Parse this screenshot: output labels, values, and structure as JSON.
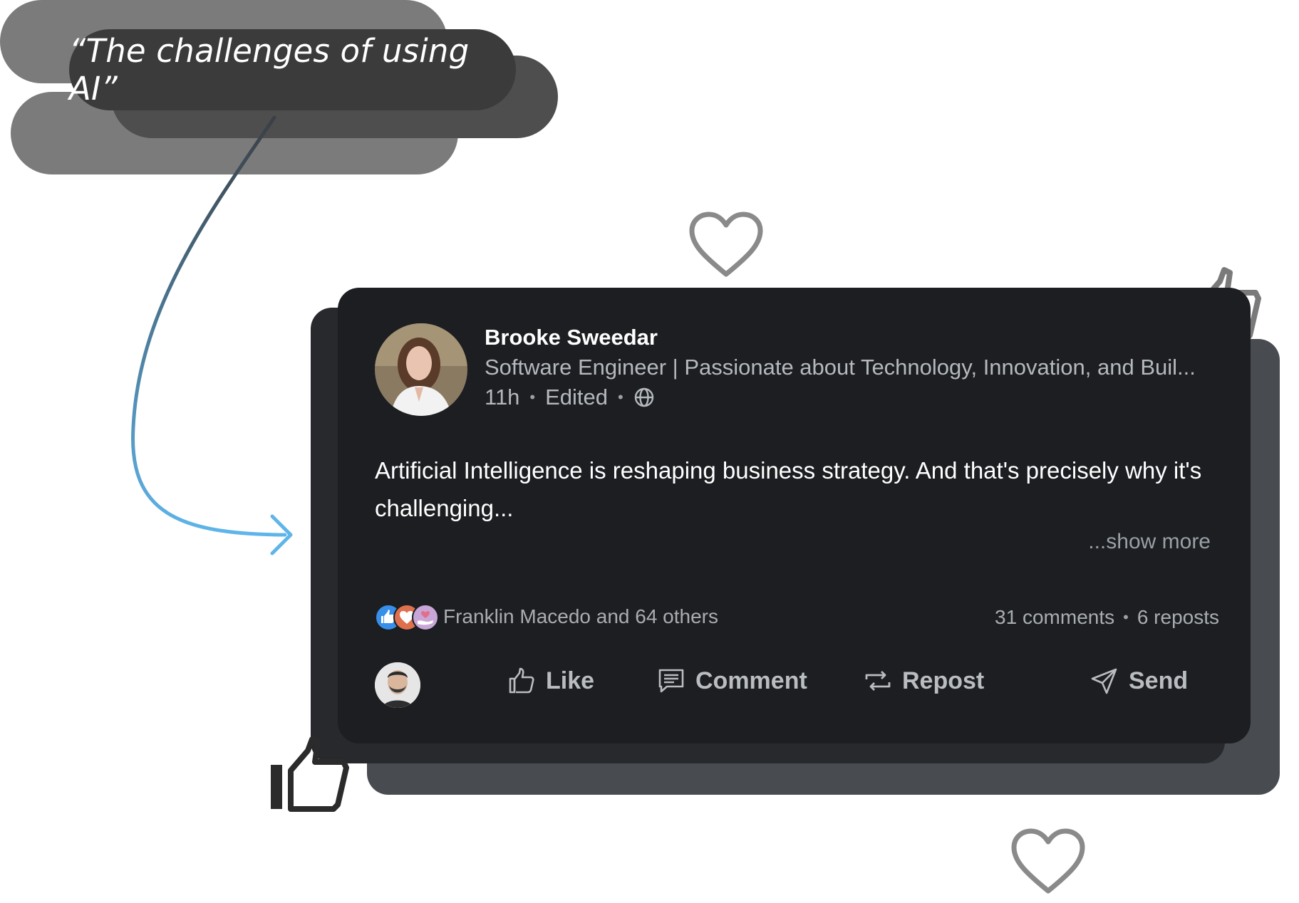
{
  "quote": {
    "text": "“The challenges of using AI”"
  },
  "post": {
    "author": {
      "name": "Brooke Sweedar",
      "headline": "Software Engineer | Passionate about Technology, Innovation, and Buil...",
      "time": "11h",
      "edited": "Edited",
      "visibility_icon": "globe-icon"
    },
    "body": "Artificial Intelligence is reshaping business strategy. And that's precisely why it's challenging...",
    "show_more": "...show more",
    "reactions": {
      "icons": [
        "like-reaction-icon",
        "love-reaction-icon",
        "support-reaction-icon"
      ],
      "summary": "Franklin Macedo and 64 others"
    },
    "stats": {
      "comments": "31 comments",
      "reposts": "6 reposts"
    },
    "actions": {
      "like": "Like",
      "comment": "Comment",
      "repost": "Repost",
      "send": "Send"
    }
  },
  "colors": {
    "card_background": "#1c1e21",
    "arrow_start": "#3a3f45",
    "arrow_end": "#5fb5ea",
    "decor_heart": "#8a8a8a",
    "decor_thumb": "#2b2b2b"
  }
}
